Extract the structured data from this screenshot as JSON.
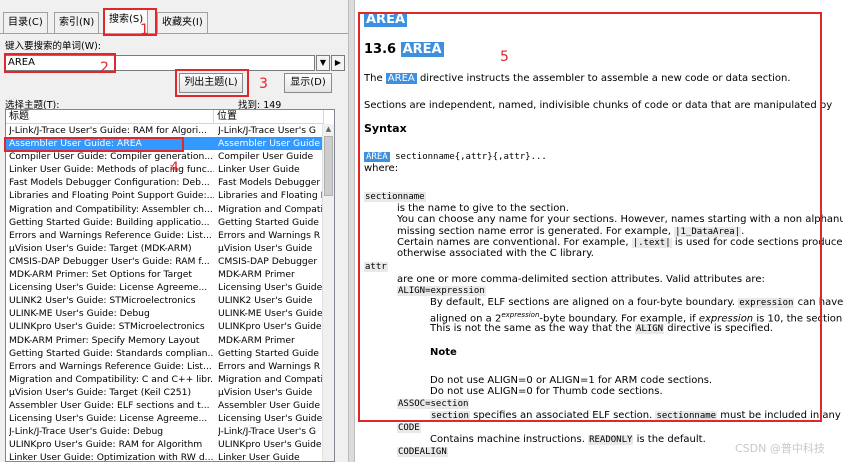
{
  "left": {
    "tabs": [
      "目录(C)",
      "索引(N)",
      "搜索(S)",
      "收藏夹(I)"
    ],
    "search_label": "键入要搜索的单词(W):",
    "search_value": "AREA",
    "list_topics_button": "列出主题(L)",
    "display_button": "显示(D)",
    "select_topic_label": "选择主题(T):",
    "found_count": "找到: 149",
    "col_title": "标题",
    "col_location": "位置",
    "rows": [
      [
        "J-Link/J-Trace User's Guide: RAM for Algori...",
        "J-Link/J-Trace User's G"
      ],
      [
        "Assembler User Guide: AREA",
        "Assembler User Guide"
      ],
      [
        "Compiler User Guide: Compiler generation...",
        "Compiler User Guide"
      ],
      [
        "Linker User Guide: Methods of placing func...",
        "Linker User Guide"
      ],
      [
        "Fast Models Debugger Configuration: Deb...",
        "Fast Models Debugger"
      ],
      [
        "Libraries and Floating Point Support Guide:...",
        "Libraries and Floating I"
      ],
      [
        "Migration and Compatibility: Assembler ch...",
        "Migration and Compati"
      ],
      [
        "Getting Started Guide: Building applicatio...",
        "Getting Started Guide"
      ],
      [
        "Errors and Warnings Reference Guide: List...",
        "Errors and Warnings R"
      ],
      [
        "µVision User's Guide: Target (MDK-ARM)",
        "µVision User's Guide"
      ],
      [
        "CMSIS-DAP Debugger User's Guide: RAM f...",
        "CMSIS-DAP Debugger"
      ],
      [
        "MDK-ARM Primer: Set Options for Target",
        "MDK-ARM Primer"
      ],
      [
        "Licensing User's Guide: License Agreeme...",
        "Licensing User's Guide"
      ],
      [
        "ULINK2 User's Guide: STMicroelectronics",
        "ULINK2 User's Guide"
      ],
      [
        "ULINK-ME User's Guide: Debug",
        "ULINK-ME User's Guide"
      ],
      [
        "ULINKpro User's Guide: STMicroelectronics",
        "ULINKpro User's Guide"
      ],
      [
        "MDK-ARM Primer: Specify Memory Layout",
        "MDK-ARM Primer"
      ],
      [
        "Getting Started Guide: Standards complian...",
        "Getting Started Guide"
      ],
      [
        "Errors and Warnings Reference Guide: List...",
        "Errors and Warnings R"
      ],
      [
        "Migration and Compatibility: C and C++ libr...",
        "Migration and Compati"
      ],
      [
        "µVision User's Guide: Target (Keil C251)",
        "µVision User's Guide"
      ],
      [
        "Assembler User Guide: ELF sections and t...",
        "Assembler User Guide"
      ],
      [
        "Licensing User's Guide: License Agreeme...",
        "Licensing User's Guide"
      ],
      [
        "J-Link/J-Trace User's Guide: Debug",
        "J-Link/J-Trace User's G"
      ],
      [
        "ULINKpro User's Guide: RAM for Algorithm",
        "ULINKpro User's Guide"
      ],
      [
        "Linker User Guide: Optimization with RW d...",
        "Linker User Guide"
      ]
    ]
  },
  "doc": {
    "heading": "AREA",
    "section_num": "13.6",
    "section_title": "AREA",
    "intro_pre": "The",
    "intro_hl": "AREA",
    "intro_post": "directive instructs the assembler to assemble a new code or data section.",
    "p2": "Sections are independent, named, indivisible chunks of code or data that are manipulated by",
    "syntax_heading": "Syntax",
    "syntax_kw": "AREA",
    "syntax_rest": "sectionname{,attr}{,attr}...",
    "where": "where:",
    "sectionname_term": "sectionname",
    "sn_line1": "is the name to give to the section.",
    "sn_line2": "You can choose any name for your sections. However, names starting with a non alphanumeric",
    "sn_line3_pre": "missing section name error is generated. For example,",
    "sn_line3_code": "|1_DataArea|",
    "sn_line3_post": ".",
    "sn_line4_pre": "Certain names are conventional. For example,",
    "sn_line4_code": "|.text|",
    "sn_line4_post": "is used for code sections produced",
    "sn_line5": "otherwise associated with the C library.",
    "attr_term": "attr",
    "attr_desc": "are one or more comma-delimited section attributes. Valid attributes are:",
    "align_term": "ALIGN=expression",
    "align_l1_pre": "By default, ELF sections are aligned on a four-byte boundary.",
    "align_l1_code": "expression",
    "align_l1_post": "can have",
    "align_l2_pre": "aligned on a 2",
    "align_l2_sup": "expression",
    "align_l2_mid": "-byte boundary. For example, if",
    "align_l2_it": "expression",
    "align_l2_post": "is 10, the section",
    "align_l3_pre": "This is not the same as the way that the",
    "align_l3_code": "ALIGN",
    "align_l3_post": "directive is specified.",
    "note_heading": "Note",
    "note_l1": "Do not use ALIGN=0 or ALIGN=1 for ARM code sections.",
    "note_l2": "Do not use ALIGN=0 for Thumb code sections.",
    "assoc_term": "ASSOC=section",
    "assoc_code": "section",
    "assoc_mid": "specifies an associated ELF section.",
    "assoc_code2": "sectionname",
    "assoc_post": "must be included in any",
    "code_term": "CODE",
    "code_desc_pre": "Contains machine instructions.",
    "code_desc_code": "READONLY",
    "code_desc_post": "is the default.",
    "codealign_term": "CODEALIGN"
  },
  "annotations": [
    "1",
    "2",
    "3",
    "4",
    "5"
  ],
  "watermark": "CSDN @普中科技",
  "colors": {
    "annotation_red": "#e0272c",
    "selection_blue": "#3399ff",
    "keyword_highlight": "#3d8fe0"
  }
}
